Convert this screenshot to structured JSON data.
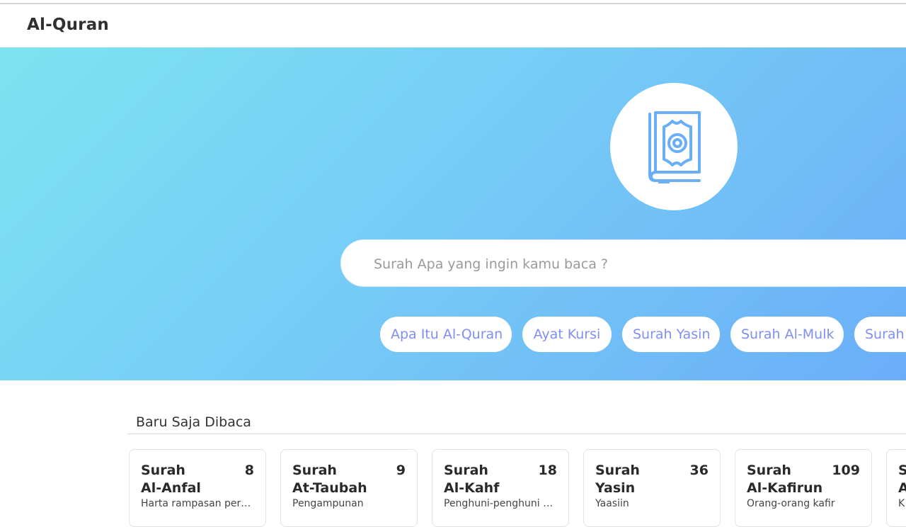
{
  "navbar": {
    "brand": "Al-Quran"
  },
  "hero": {
    "logo_icon": "quran-book-icon",
    "search": {
      "placeholder": "Surah Apa yang ingin kamu baca ?",
      "value": ""
    },
    "chips": [
      "Apa Itu Al-Quran",
      "Ayat Kursi",
      "Surah Yasin",
      "Surah Al-Mulk",
      "Surah"
    ]
  },
  "recent": {
    "title": "Baru Saja Dibaca",
    "cards": [
      {
        "prefix": "Surah",
        "name": "Al-Anfal",
        "number": "8",
        "meaning": "Harta rampasan perang"
      },
      {
        "prefix": "Surah",
        "name": "At-Taubah",
        "number": "9",
        "meaning": "Pengampunan"
      },
      {
        "prefix": "Surah",
        "name": "Al-Kahf",
        "number": "18",
        "meaning": "Penghuni-penghuni gua"
      },
      {
        "prefix": "Surah",
        "name": "Yasin",
        "number": "36",
        "meaning": "Yaasiin"
      },
      {
        "prefix": "Surah",
        "name": "Al-Kafirun",
        "number": "109",
        "meaning": "Orang-orang kafir"
      },
      {
        "prefix": "S",
        "name": "A",
        "number": "",
        "meaning": "K"
      }
    ]
  },
  "colors": {
    "hero_gradient_start": "#7ee3f1",
    "hero_gradient_end": "#6aaef8",
    "chip_text": "#7f8ff3",
    "logo_stroke": "#6aaef8"
  }
}
